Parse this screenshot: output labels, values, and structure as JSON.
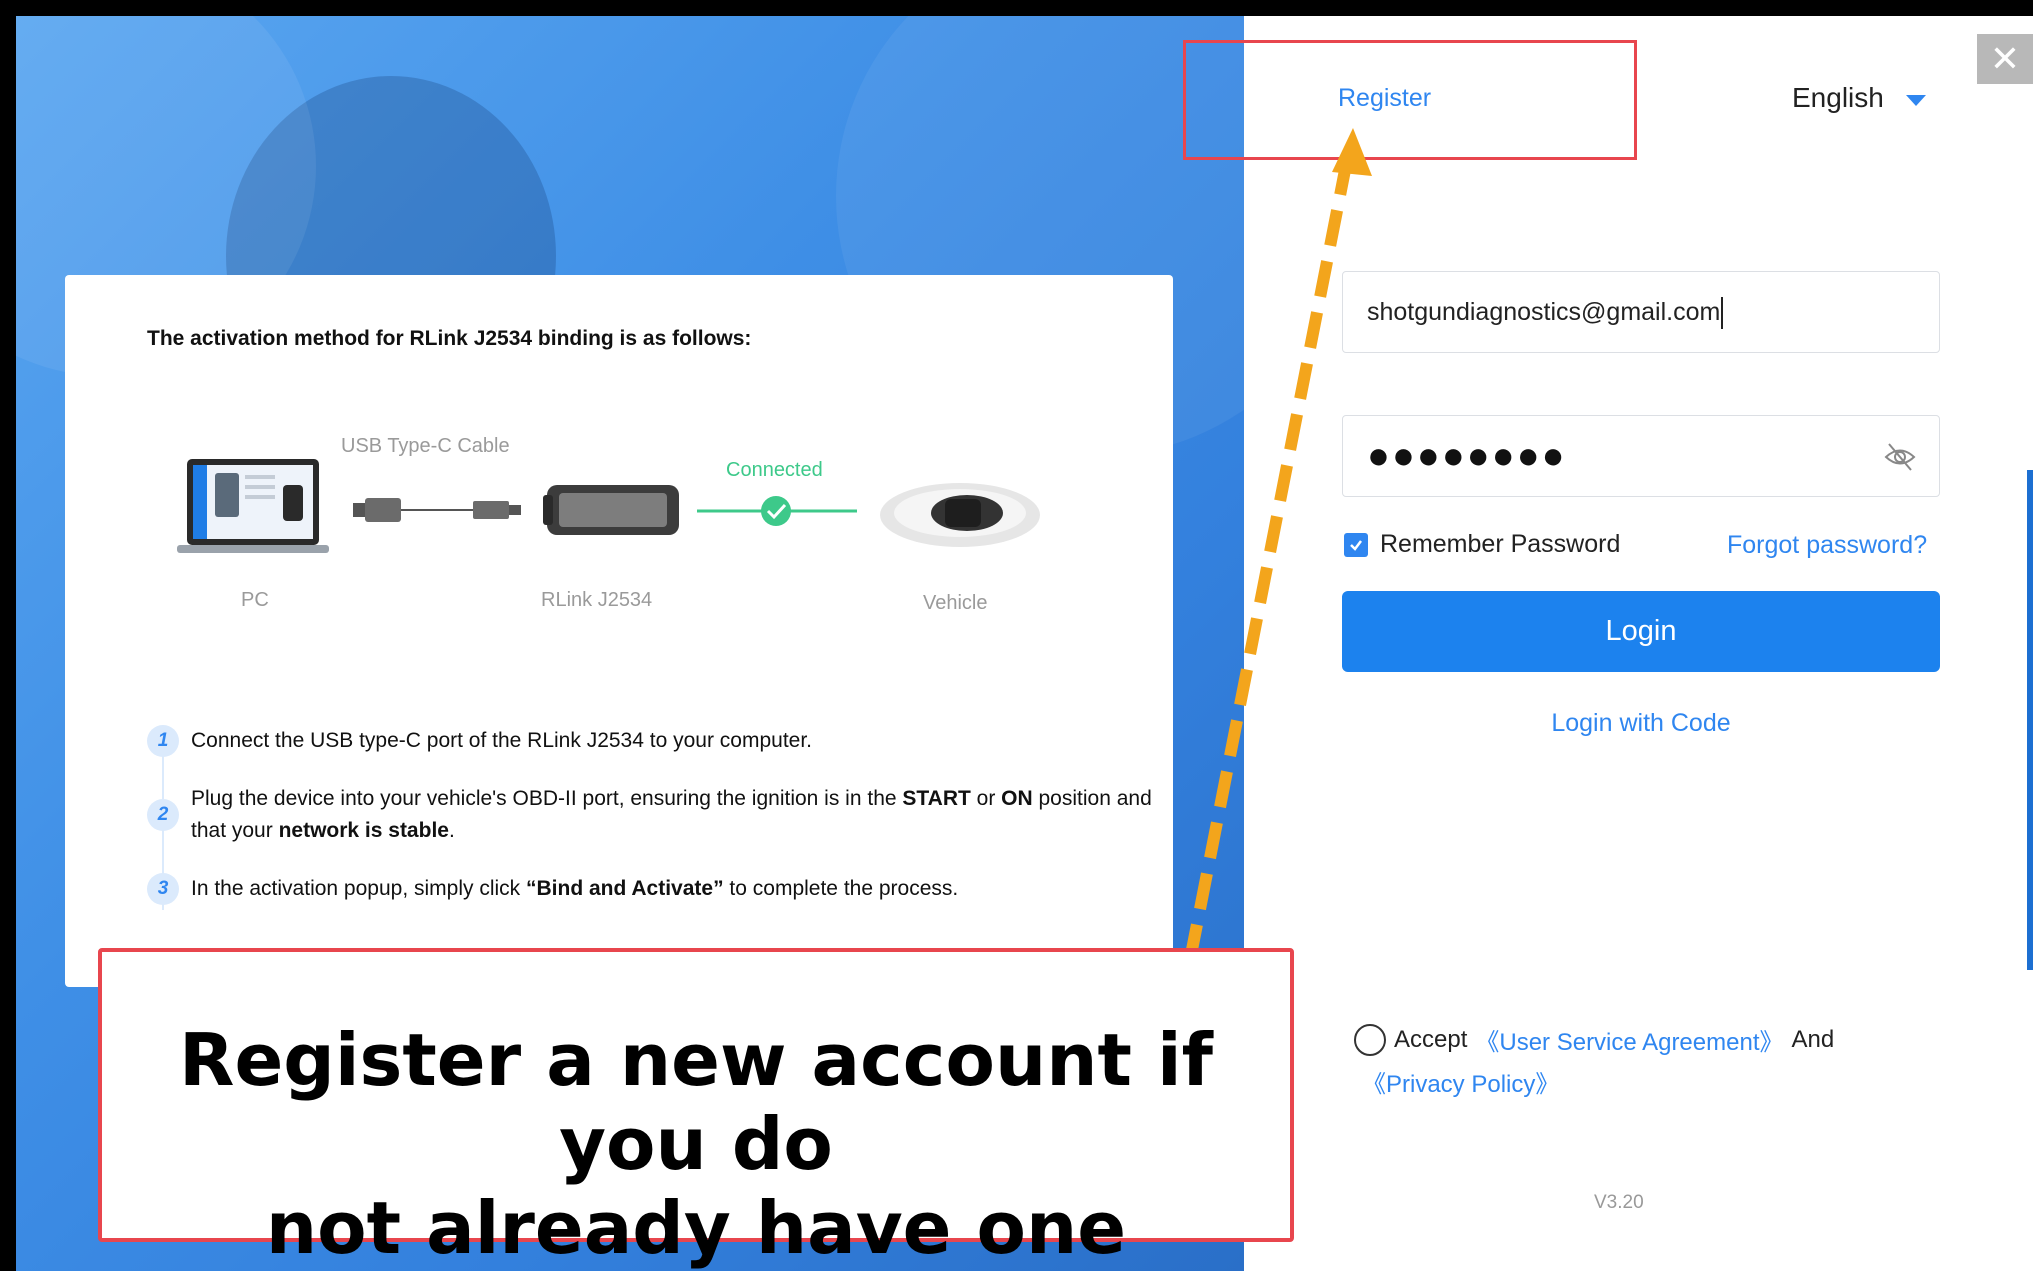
{
  "window": {
    "close_glyph": "✕"
  },
  "header": {
    "register_label": "Register",
    "language_label": "English"
  },
  "login_form": {
    "email_value": "shotgundiagnostics@gmail.com",
    "password_mask": "●●●●●●●●",
    "remember_label": "Remember Password",
    "remember_checked": true,
    "forgot_label": "Forgot password?",
    "login_button": "Login",
    "login_with_code": "Login with Code"
  },
  "agreement": {
    "accept_label": "Accept",
    "user_agreement": "《User Service Agreement》",
    "and_label": "And",
    "privacy_policy": "《Privacy Policy》"
  },
  "version": "V3.20",
  "info_card": {
    "heading": "The activation method for RLink J2534 binding is as follows:",
    "diagram": {
      "cable_label": "USB Type-C Cable",
      "connected_label": "Connected",
      "pc_label": "PC",
      "device_label": "RLink J2534",
      "vehicle_label": "Vehicle"
    },
    "steps": [
      {
        "num": "1",
        "text": "Connect the USB type-C port of the RLink J2534 to your computer."
      },
      {
        "num": "2",
        "text_a": "Plug the device into your vehicle's OBD-II port, ensuring the ignition is in the ",
        "bold_a": "START",
        "text_b": " or ",
        "bold_b": "ON",
        "text_c": " position and that your ",
        "bold_c": "network is stable",
        "text_d": "."
      },
      {
        "num": "3",
        "text_a": "In the activation popup, simply click ",
        "bold_a": "“Bind and Activate”",
        "text_b": " to complete the process."
      }
    ]
  },
  "annotation": {
    "callout_text_line1": "Register a new account if you do",
    "callout_text_line2": "not already have one"
  },
  "colors": {
    "accent": "#2f86f0",
    "highlight_red": "#e8464e",
    "arrow_orange": "#f3a51c",
    "connected_green": "#3dc98a"
  }
}
